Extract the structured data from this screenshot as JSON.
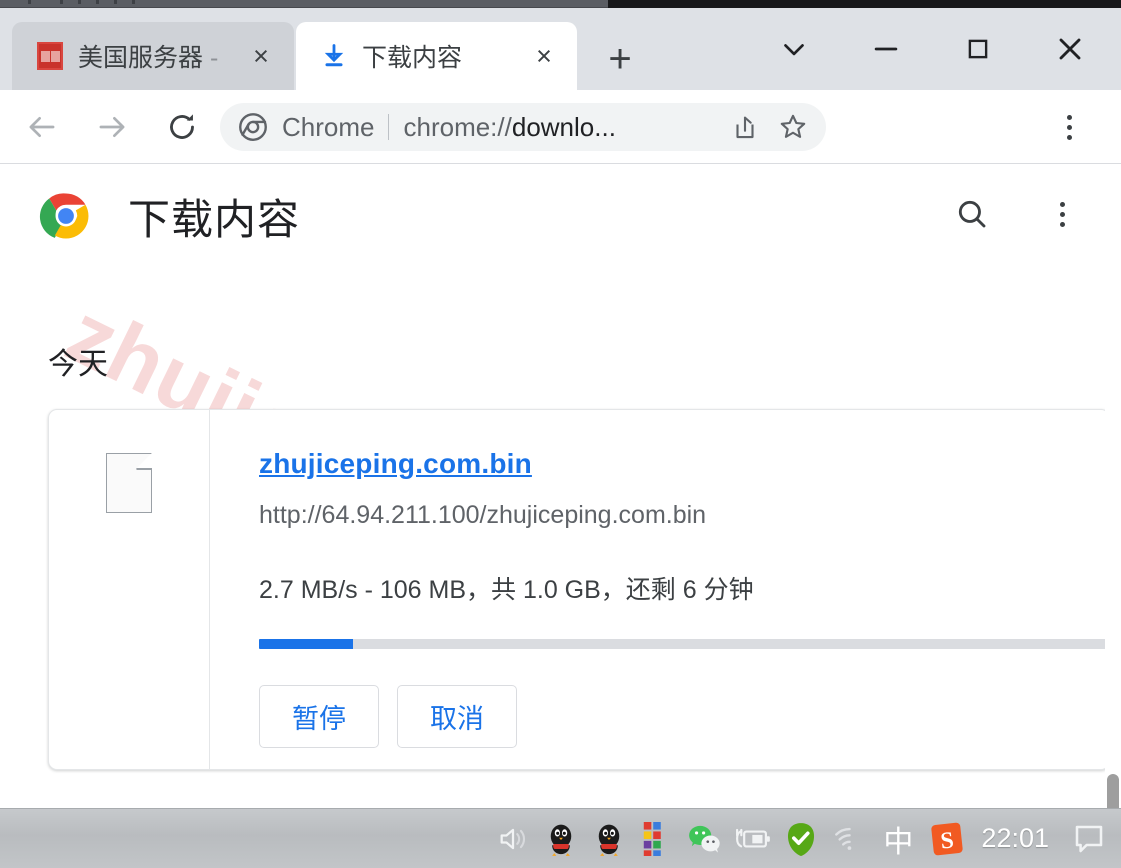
{
  "window": {
    "controls": [
      {
        "name": "tab-search",
        "glyph": "chevron-down"
      },
      {
        "name": "minimize",
        "glyph": "minus"
      },
      {
        "name": "maximize",
        "glyph": "square"
      },
      {
        "name": "close",
        "glyph": "x"
      }
    ]
  },
  "tabs": [
    {
      "title": "美国服务器",
      "suffix": " - ",
      "favicon": "red-seal-icon",
      "active": false,
      "close_label": "×"
    },
    {
      "title": "下载内容",
      "favicon": "download-icon",
      "active": true,
      "close_label": "×"
    }
  ],
  "new_tab_label": "+",
  "toolbar": {
    "back_icon": "arrow-left-icon",
    "forward_icon": "arrow-right-icon",
    "reload_icon": "reload-icon",
    "omnibox": {
      "scheme_label": "Chrome",
      "url_text": "chrome://downlo...",
      "url_prefix": "chrome://",
      "url_body": "downlo...",
      "share_icon": "share-icon",
      "bookmark_icon": "star-icon"
    },
    "menu_icon": "three-dot-menu-icon"
  },
  "page": {
    "title": "下载内容",
    "logo": "chrome-logo",
    "search_icon": "search-icon",
    "menu_icon": "three-dot-menu-icon",
    "section_date": "今天",
    "watermark": "zhujiceping.com",
    "download": {
      "file_icon": "file-icon",
      "filename": "zhujiceping.com.bin",
      "url": "http://64.94.211.100/zhujiceping.com.bin",
      "status": "2.7 MB/s - 106 MB，共 1.0 GB，还剩 6 分钟",
      "speed": "2.7 MB/s",
      "downloaded": "106 MB",
      "total": "1.0 GB",
      "remaining": "还剩 6 分钟",
      "progress_percent": 11,
      "progress_color": "#1a73e8",
      "buttons": [
        {
          "name": "pause-button",
          "label": "暂停"
        },
        {
          "name": "cancel-button",
          "label": "取消"
        }
      ]
    }
  },
  "taskbar": {
    "tray_icons": [
      "speaker-icon",
      "qq-penguin-icon",
      "qq-penguin-icon",
      "color-grid-icon",
      "wechat-icon",
      "battery-charging-icon",
      "green-check-icon",
      "wifi-icon"
    ],
    "ime_label": "中",
    "sogou_label": "S",
    "clock": "22:01",
    "notification_icon": "notification-icon"
  },
  "colors": {
    "accent": "#1a73e8",
    "tabstrip": "#dee1e6",
    "watermark": "#f7d9d9",
    "link": "#1a73e8"
  }
}
